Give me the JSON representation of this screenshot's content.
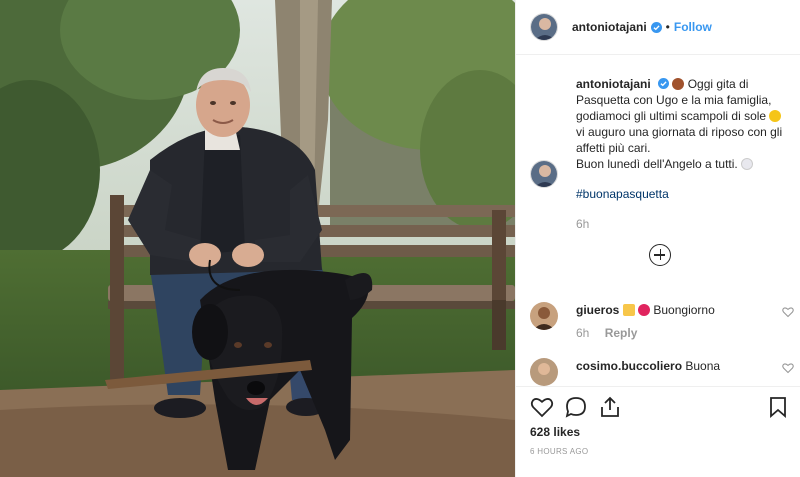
{
  "header": {
    "username": "antoniotajani",
    "separator": "•",
    "follow_label": "Follow"
  },
  "caption": {
    "username": "antoniotajani",
    "text_a": "Oggi gita di Pasquetta con Ugo e la mia famiglia, godiamoci gli ultimi scampoli di sole",
    "text_b": "vi auguro una giornata di riposo con gli affetti più cari.",
    "text_c": "Buon lunedì dell'Angelo a tutti.",
    "hashtag": "#buonapasquetta",
    "time": "6h"
  },
  "comments": [
    {
      "username": "giueros",
      "text": "Buongiorno",
      "time": "6h",
      "reply_label": "Reply"
    },
    {
      "username": "cosimo.buccoliero",
      "text": "Buona"
    }
  ],
  "actions": {
    "likes": "628 likes",
    "timestamp": "6 HOURS AGO"
  },
  "colors": {
    "accent": "#3897f0",
    "heart": "#ed4956",
    "text": "#262626",
    "muted": "#999999"
  }
}
